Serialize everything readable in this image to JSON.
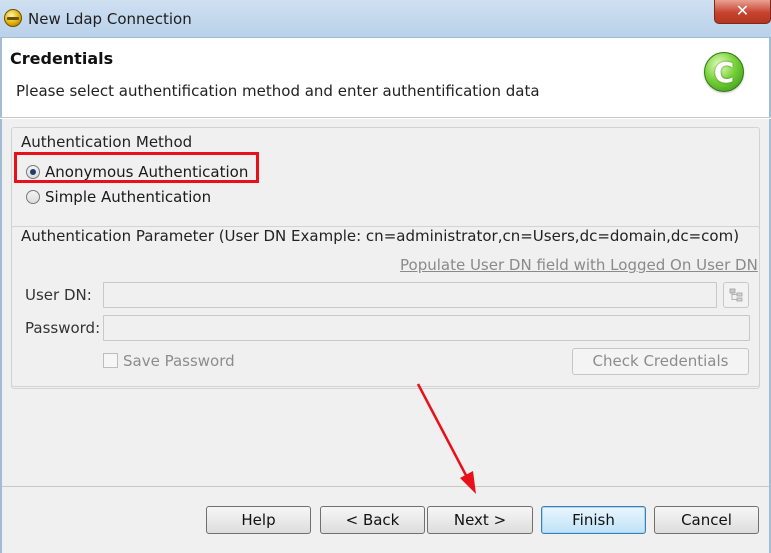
{
  "window": {
    "title": "New Ldap Connection",
    "close_label": "✕"
  },
  "header": {
    "title": "Credentials",
    "description": "Please select authentification method and enter authentification data",
    "logo_letter": "C"
  },
  "auth_method": {
    "legend": "Authentication Method",
    "options": [
      {
        "label": "Anonymous Authentication",
        "checked": true
      },
      {
        "label": "Simple Authentication",
        "checked": false
      }
    ]
  },
  "auth_params": {
    "legend": "Authentication Parameter (User DN Example: cn=administrator,cn=Users,dc=domain,dc=com)",
    "populate_link": "Populate User DN field with Logged On User DN",
    "user_dn_label": "User DN:",
    "user_dn_value": "",
    "password_label": "Password:",
    "password_value": "",
    "save_password_label": "Save Password",
    "save_password_checked": false,
    "check_credentials_label": "Check Credentials"
  },
  "buttons": {
    "help": "Help",
    "back": "< Back",
    "next": "Next >",
    "finish": "Finish",
    "cancel": "Cancel"
  },
  "colors": {
    "highlight_box": "#e8111a",
    "annotation_arrow": "#e8111a"
  }
}
